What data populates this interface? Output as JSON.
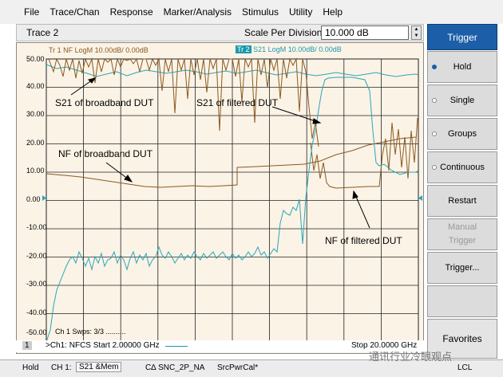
{
  "menu": [
    "File",
    "Trace/Chan",
    "Response",
    "Marker/Analysis",
    "Stimulus",
    "Utility",
    "Help"
  ],
  "trace_bar": {
    "trace_name": "Trace 2",
    "scale_label": "Scale Per Division",
    "scale_value": "10.000 dB"
  },
  "plot": {
    "trace1_label": "Tr 1  NF LogM 10.00dB/  0.00dB",
    "trace2_tag": "Tr 2",
    "trace2_label": " S21 LogM 10.00dB/  0.00dB",
    "y_ticks": [
      "50.00",
      "40.00",
      "30.00",
      "20.00",
      "10.00",
      "0.00",
      "-10.00",
      "-20.00",
      "-30.00",
      "-40.00",
      "-50.00"
    ],
    "annotations": {
      "s21_broadband": "S21 of broadband DUT",
      "s21_filtered": "S21 of filtered DUT",
      "nf_broadband": "NF of broadband DUT",
      "nf_filtered": "NF of filtered DUT"
    },
    "channel_info": "Ch 1  Swps: 3/3 ..........",
    "colors": {
      "nf_trace": "#8a5a20",
      "s21_trace": "#2aa6b8",
      "grid": "#000000"
    }
  },
  "sweep": {
    "number": "1",
    "start": ">Ch1: NFCS Start  2.00000 GHz",
    "stop": "Stop  20.0000 GHz"
  },
  "status_bar": {
    "hold": "Hold",
    "ch": "CH 1:",
    "meas": "S21 &Mem",
    "cal": "C∆ SNC_2P_NA",
    "pwr": "SrcPwrCal*",
    "lcl": "LCL"
  },
  "softkeys": {
    "title": "Trigger",
    "hold": "Hold",
    "single": "Single",
    "groups": "Groups",
    "continuous": "Continuous",
    "restart": "Restart",
    "manual1": "Manual",
    "manual2": "Trigger",
    "trigger_dots": "Trigger...",
    "favorites": "Favorites"
  },
  "watermark": "通讯行业冷眼观点"
}
